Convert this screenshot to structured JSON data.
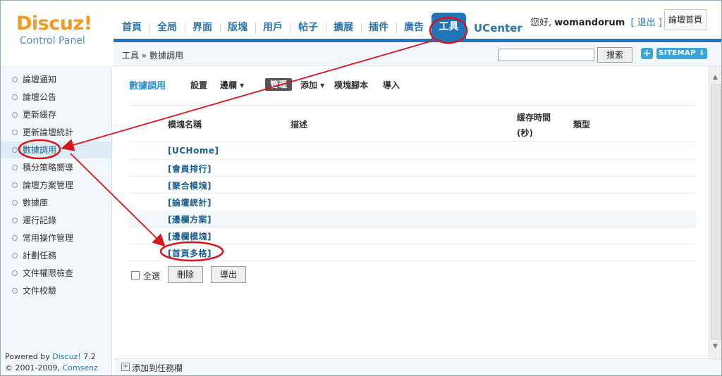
{
  "header": {
    "logo_main": "Discuz!",
    "logo_sub": "Control Panel",
    "nav": [
      "首頁",
      "全局",
      "界面",
      "版塊",
      "用戶",
      "帖子",
      "擴展",
      "插件",
      "廣告"
    ],
    "nav_active": "工具",
    "nav_ucenter": "UCenter",
    "greeting": "您好,",
    "username": "womandorum",
    "logout": "[ 退出 ]",
    "home_button": "論壇首頁"
  },
  "subbar": {
    "breadcrumb": "工具 » 數據調用",
    "search_button": "搜索",
    "plus": "+",
    "sitemap": "SITEMAP ⇓"
  },
  "sidebar": {
    "items": [
      "論壇通知",
      "論壇公告",
      "更新緩存",
      "更新論壇統計",
      "數據調用",
      "積分策略嚮導",
      "論壇方案管理",
      "數據庫",
      "運行記錄",
      "常用操作管理",
      "計劃任務",
      "文件權限檢查",
      "文件校驗"
    ],
    "powered_prefix": "Powered by ",
    "powered_link": "Discuz!",
    "powered_version": " 7.2",
    "copyright_prefix": "© 2001-2009, ",
    "copyright_link": "Comsenz Inc."
  },
  "main": {
    "title": "數據調用",
    "tabs": [
      "設置",
      "邊欄 ▾",
      "管理",
      "添加 ▾",
      "模塊腳本",
      "導入"
    ],
    "columns": [
      "模塊名稱",
      "描述",
      "緩存時間",
      "(秒)",
      "類型"
    ],
    "rows": [
      "[UCHome]",
      "[會員排行]",
      "[聚合模塊]",
      "[論壇統計]",
      "[邊欄方案]",
      "[邊欄模塊]",
      "[首頁多格]"
    ],
    "select_all": "全選",
    "delete_button": "刪除",
    "export_button": "導出"
  },
  "taskbar": {
    "add_label": "添加到任務欄"
  },
  "colors": {
    "accent": "#1f75b8",
    "link": "#1d5f8c",
    "annotation": "#d9141b"
  }
}
